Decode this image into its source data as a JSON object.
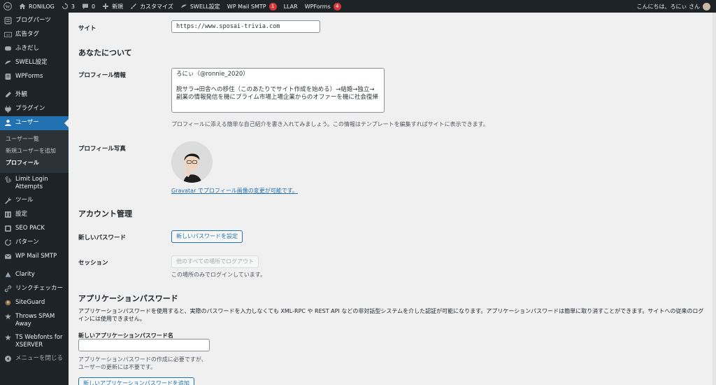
{
  "adminbar": {
    "site_name": "RONILOG",
    "updates_count": "3",
    "comments_count": "0",
    "new_label": "新規",
    "customize_label": "カスタマイズ",
    "swell_label": "SWELL設定",
    "wp_mail_label": "WP Mail SMTP",
    "wp_mail_badge": "1",
    "llar_label": "LLAR",
    "wpforms_label": "WPForms",
    "wpforms_badge": "4",
    "greeting": "こんにちは、ろにぃ さん"
  },
  "sidebar": {
    "items": [
      {
        "label": "ブログパーツ",
        "icon": "blog-parts-icon"
      },
      {
        "label": "広告タグ",
        "icon": "ad-tag-icon"
      },
      {
        "label": "ふきだし",
        "icon": "balloon-icon"
      },
      {
        "label": "SWELL設定",
        "icon": "swell-icon"
      },
      {
        "label": "WPForms",
        "icon": "wpforms-icon"
      },
      {
        "label": "外観",
        "icon": "appearance-icon"
      },
      {
        "label": "プラグイン",
        "icon": "plugins-icon"
      },
      {
        "label": "ユーザー",
        "icon": "users-icon"
      },
      {
        "label": "Limit Login Attempts",
        "icon": "fingerprint-icon"
      },
      {
        "label": "ツール",
        "icon": "tools-icon"
      },
      {
        "label": "設定",
        "icon": "settings-icon"
      },
      {
        "label": "SEO PACK",
        "icon": "seo-pack-icon"
      },
      {
        "label": "パターン",
        "icon": "patterns-icon"
      },
      {
        "label": "WP Mail SMTP",
        "icon": "mail-icon"
      },
      {
        "label": "Clarity",
        "icon": "clarity-icon"
      },
      {
        "label": "リンクチェッカー",
        "icon": "link-checker-icon"
      },
      {
        "label": "SiteGuard",
        "icon": "siteguard-icon"
      },
      {
        "label": "Throws SPAM Away",
        "icon": "spam-icon"
      },
      {
        "label": "TS Webfonts for XSERVER",
        "icon": "webfonts-icon"
      },
      {
        "label": "メニューを閉じる",
        "icon": "collapse-icon"
      }
    ],
    "submenu": [
      "ユーザー一覧",
      "新規ユーザーを追加",
      "プロフィール"
    ]
  },
  "main": {
    "site_label": "サイト",
    "site_value": "https://www.sposai-trivia.com",
    "about_heading": "あなたについて",
    "bio_label": "プロフィール情報",
    "bio_text": "ろにぃ（@ronnie_2020）\n\n脱サラ→田舎への移住（このあたりでサイト作成を始める）→結婚→独立→\n副業の情報発信を機にプライム市場上場企業からのオファーを機に社会復帰",
    "bio_desc": "プロフィールに添える簡単な自己紹介を書き入れてみましょう。この情報はテンプレートを編集すればサイトに表示できます。",
    "photo_label": "プロフィール写真",
    "gravatar_link": "Gravatar でプロフィール画像の変更が可能です。",
    "account_heading": "アカウント管理",
    "new_password_label": "新しいパスワード",
    "set_password_button": "新しいパスワードを設定",
    "session_label": "セッション",
    "logout_button": "他のすべての場所でログアウト",
    "session_desc": "この場所のみでログインしています。",
    "app_password_heading": "アプリケーションパスワード",
    "app_password_desc": "アプリケーションパスワードを使用すると、実際のパスワードを入力しなくても XML-RPC や REST API などの非対話型システムを介した認証が可能になります。アプリケーションパスワードは簡単に取り消すことができます。サイトへの従来のログインには使用できません。",
    "app_name_label": "新しいアプリケーションパスワード名",
    "app_name_value": "",
    "app_name_desc_1": "アプリケーションパスワードの作成に必要ですが、",
    "app_name_desc_2": "ユーザーの更新には不要です。",
    "add_app_password_button": "新しいアプリケーションパスワードを追加"
  }
}
